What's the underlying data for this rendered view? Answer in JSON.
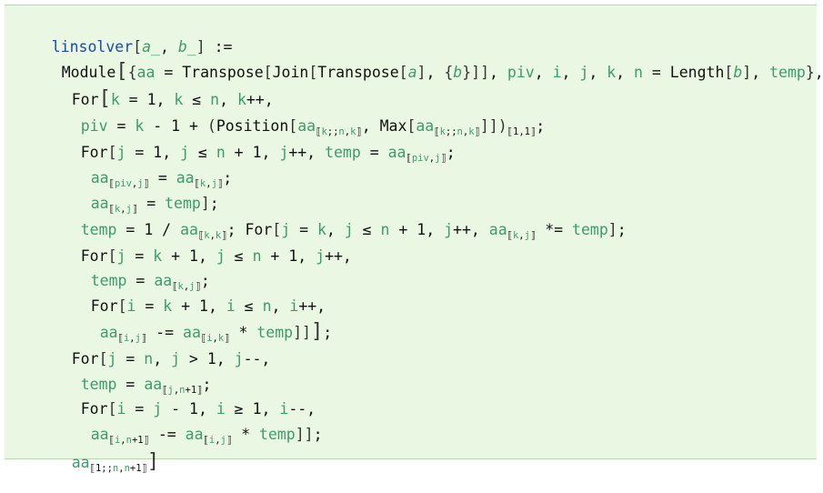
{
  "cell": {
    "kind": "input",
    "language": "Mathematica",
    "background": "#e9f7e3"
  },
  "code_lines": [
    "linsolver[a_, b_] :=",
    "Module[{aa = Transpose[Join[Transpose[a], {b}]], piv, i, j, k, n = Length[b], temp},",
    "For[k = 1, k ≤ n, k++,",
    "piv = k - 1 + (Position[aa⟦k;;n,k⟧, Max[aa⟦k;;n,k⟧]])⟦1,1⟧;",
    "For[j = 1, j ≤ n + 1, j++, temp = aa⟦piv,j⟧;",
    "aa⟦piv,j⟧ = aa⟦k,j⟧;",
    "aa⟦k,j⟧ = temp];",
    "temp = 1 / aa⟦k,k⟧; For[j = k, j ≤ n + 1, j++, aa⟦k,j⟧ *= temp];",
    "For[j = k + 1, j ≤ n + 1, j++,",
    "temp = aa⟦k,j⟧;",
    "For[i = k + 1, i ≤ n, i++,",
    "aa⟦i,j⟧ -= aa⟦i,k⟧ * temp]]];",
    "For[j = n, j > 1, j--,",
    "temp = aa⟦j,n+1⟧;",
    "For[i = j - 1, i ≥ 1, i--,",
    "aa⟦i,n+1⟧ -= aa⟦i,j⟧ * temp]];",
    "aa⟦1;;n,n+1⟧]"
  ]
}
